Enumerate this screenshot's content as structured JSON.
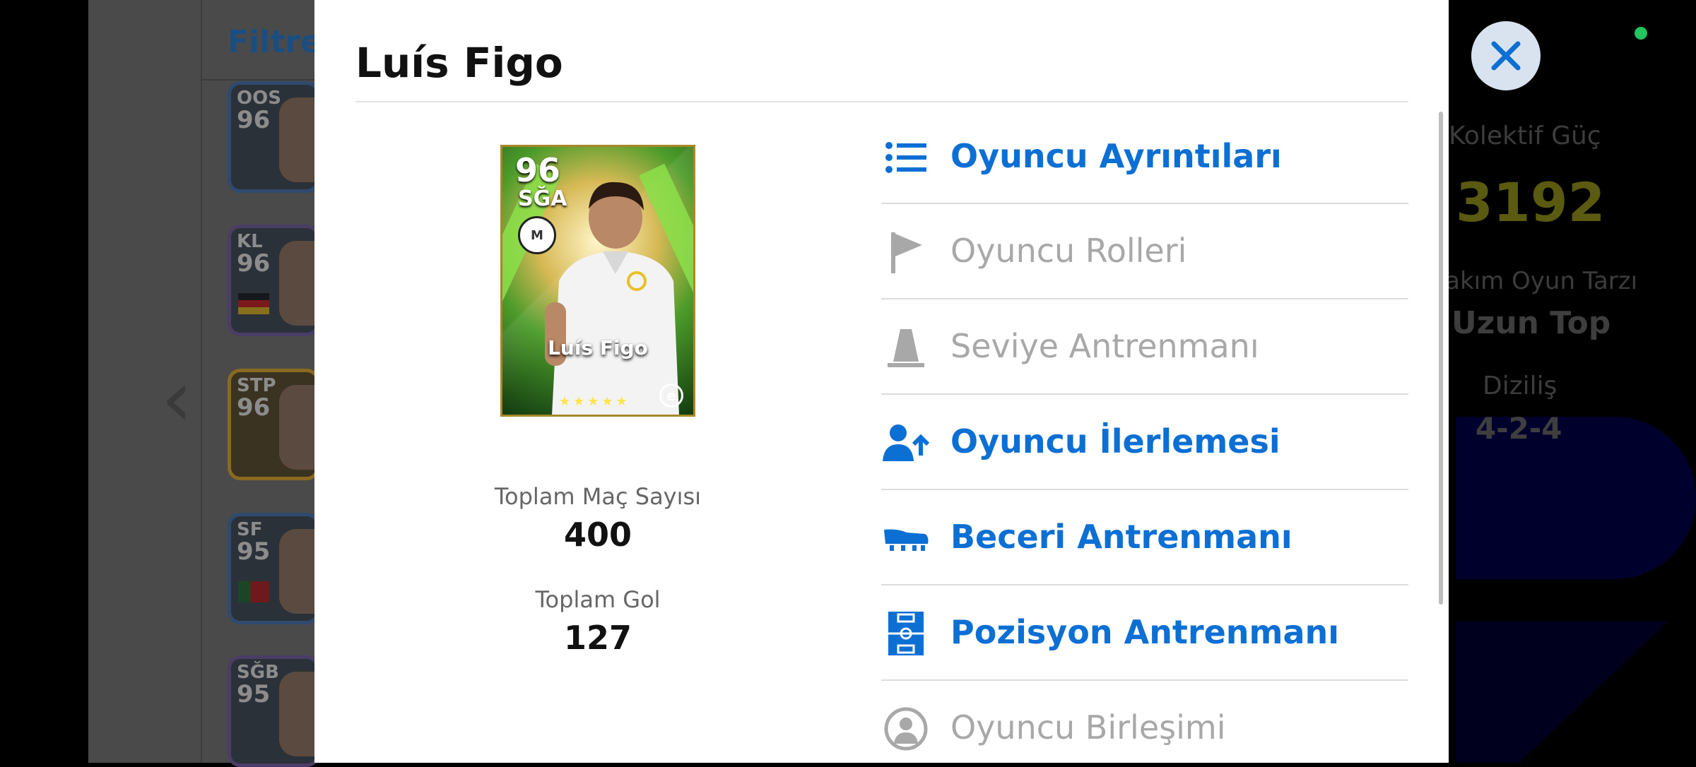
{
  "background": {
    "filter_label": "Filtre",
    "cards": [
      {
        "position": "OOS",
        "rating": "96"
      },
      {
        "position": "KL",
        "rating": "96"
      },
      {
        "position": "STP",
        "rating": "96"
      },
      {
        "position": "SF",
        "rating": "95"
      },
      {
        "position": "SĞB",
        "rating": "95"
      }
    ],
    "team_strength_label": "Kolektif Güç",
    "team_strength_value": "3192",
    "playstyle_label": "Takım Oyun Tarzı",
    "playstyle_value": "Uzun Top",
    "formation_label": "Diziliş",
    "formation_value": "4-2-4"
  },
  "modal": {
    "title": "Luís Figo",
    "card": {
      "rating": "96",
      "position": "SĞA",
      "name": "Luís Figo",
      "stars": "★★★★★"
    },
    "stats": [
      {
        "label": "Toplam Maç Sayısı",
        "value": "400"
      },
      {
        "label": "Toplam Gol",
        "value": "127"
      }
    ],
    "menu": [
      {
        "label": "Oyuncu Ayrıntıları",
        "icon": "list-icon",
        "enabled": true
      },
      {
        "label": "Oyuncu Rolleri",
        "icon": "flag-icon",
        "enabled": false
      },
      {
        "label": "Seviye Antrenmanı",
        "icon": "training-cone-icon",
        "enabled": false
      },
      {
        "label": "Oyuncu İlerlemesi",
        "icon": "player-upgrade-icon",
        "enabled": true
      },
      {
        "label": "Beceri Antrenmanı",
        "icon": "boot-icon",
        "enabled": true
      },
      {
        "label": "Pozisyon Antrenmanı",
        "icon": "pitch-icon",
        "enabled": true
      },
      {
        "label": "Oyuncu Birleşimi",
        "icon": "player-merge-icon",
        "enabled": false
      }
    ]
  },
  "colors": {
    "accent": "#0c6fd4",
    "disabled": "#a8a8a8",
    "strength_value": "#5a5a10"
  },
  "close_icon": "close-icon"
}
